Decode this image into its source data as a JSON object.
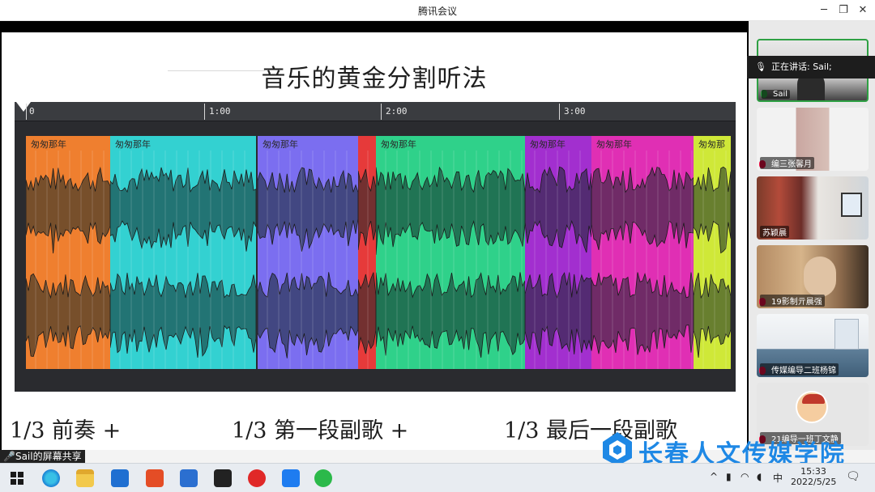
{
  "window": {
    "title": "腾讯会议",
    "min_icon": "minimize-icon",
    "max_icon": "maximize-icon",
    "close_icon": "close-icon"
  },
  "slide": {
    "title": "音乐的黄金分割听法",
    "timeline_labels": [
      "0",
      "1:00",
      "2:00",
      "3:00"
    ],
    "clip_name": "匆匆那年",
    "clip_name_cut": "匆匆那",
    "captions": [
      "1/3 前奏 +",
      "1/3 第一段副歌 +",
      "1/3 最后一段副歌"
    ]
  },
  "clip_colors": [
    "#ef7f2f",
    "#33d1d1",
    "#7b6ef0",
    "#e63a3a",
    "#2fd18a",
    "#a22fcf",
    "#e02fb4",
    "#cfe838"
  ],
  "share_label": "Sail的屏幕共享",
  "speaking": {
    "text": "正在讲话: Sail;"
  },
  "participants": [
    {
      "name": "Sail"
    },
    {
      "name": "编三张馨月"
    },
    {
      "name": "苏颖晨"
    },
    {
      "name": "19影制亓晨强"
    },
    {
      "name": "传媒编导二班杨锦"
    },
    {
      "name": "21编导一班丁文静"
    }
  ],
  "taskbar": {
    "time": "15:33",
    "date": "2022/5/25",
    "ime": "中",
    "icons": [
      "windows-start-icon",
      "search-icon",
      "edge-icon",
      "file-explorer-icon",
      "mail-icon",
      "office-icon",
      "store-icon",
      "media-player-icon",
      "netease-music-icon",
      "tencent-meeting-icon",
      "wechat-icon"
    ]
  },
  "watermark": {
    "text": "长春人文传媒学院"
  }
}
